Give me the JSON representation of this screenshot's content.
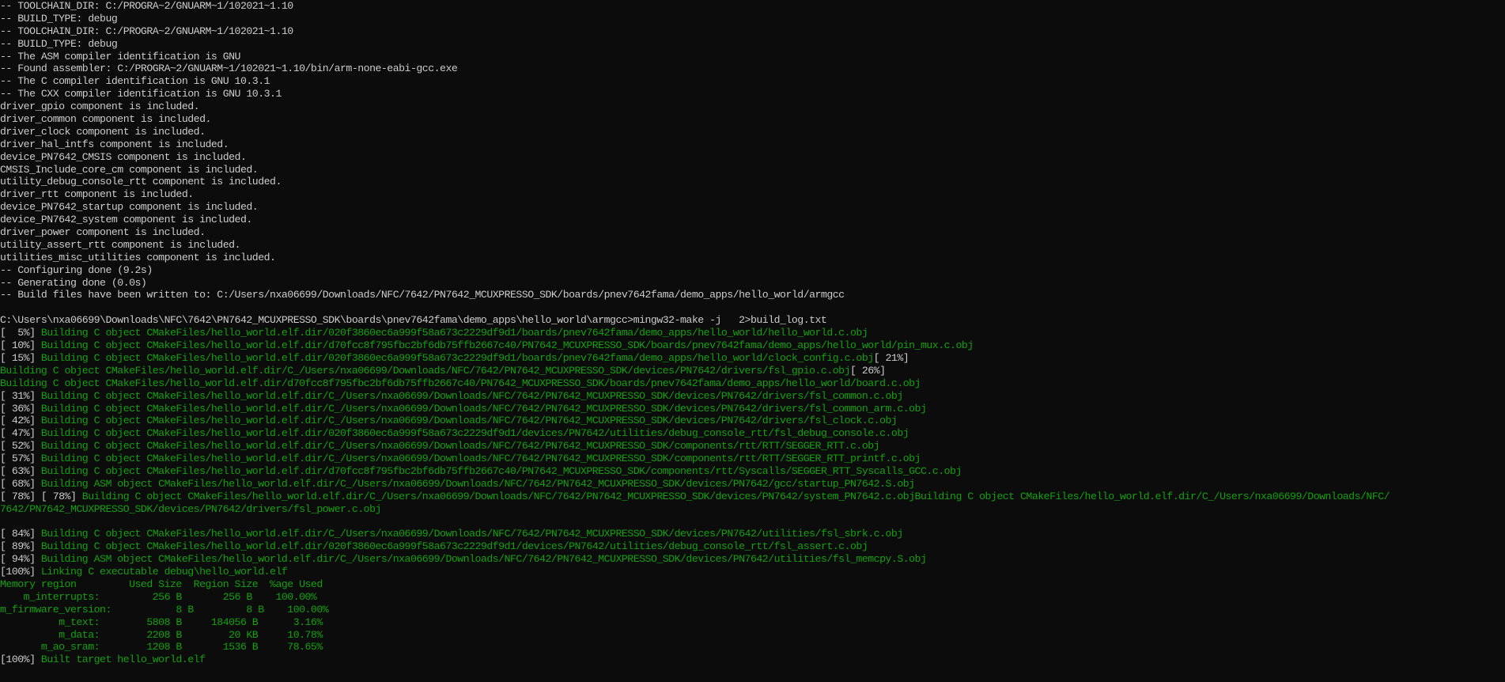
{
  "colors": {
    "background": "#0c0c0c",
    "default_text": "#cccccc",
    "build_text": "#13a10e"
  },
  "lines": [
    {
      "text": "-- TOOLCHAIN_DIR: C:/PROGRA~2/GNUARM~1/102021~1.10",
      "color": "white"
    },
    {
      "text": "-- BUILD_TYPE: debug",
      "color": "white"
    },
    {
      "text": "-- TOOLCHAIN_DIR: C:/PROGRA~2/GNUARM~1/102021~1.10",
      "color": "white"
    },
    {
      "text": "-- BUILD_TYPE: debug",
      "color": "white"
    },
    {
      "text": "-- The ASM compiler identification is GNU",
      "color": "white"
    },
    {
      "text": "-- Found assembler: C:/PROGRA~2/GNUARM~1/102021~1.10/bin/arm-none-eabi-gcc.exe",
      "color": "white"
    },
    {
      "text": "-- The C compiler identification is GNU 10.3.1",
      "color": "white"
    },
    {
      "text": "-- The CXX compiler identification is GNU 10.3.1",
      "color": "white"
    },
    {
      "text": "driver_gpio component is included.",
      "color": "white"
    },
    {
      "text": "driver_common component is included.",
      "color": "white"
    },
    {
      "text": "driver_clock component is included.",
      "color": "white"
    },
    {
      "text": "driver_hal_intfs component is included.",
      "color": "white"
    },
    {
      "text": "device_PN7642_CMSIS component is included.",
      "color": "white"
    },
    {
      "text": "CMSIS_Include_core_cm component is included.",
      "color": "white"
    },
    {
      "text": "utility_debug_console_rtt component is included.",
      "color": "white"
    },
    {
      "text": "driver_rtt component is included.",
      "color": "white"
    },
    {
      "text": "device_PN7642_startup component is included.",
      "color": "white"
    },
    {
      "text": "device_PN7642_system component is included.",
      "color": "white"
    },
    {
      "text": "driver_power component is included.",
      "color": "white"
    },
    {
      "text": "utility_assert_rtt component is included.",
      "color": "white"
    },
    {
      "text": "utilities_misc_utilities component is included.",
      "color": "white"
    },
    {
      "text": "-- Configuring done (9.2s)",
      "color": "white"
    },
    {
      "text": "-- Generating done (0.0s)",
      "color": "white"
    },
    {
      "text": "-- Build files have been written to: C:/Users/nxa06699/Downloads/NFC/7642/PN7642_MCUXPRESSO_SDK/boards/pnev7642fama/demo_apps/hello_world/armgcc",
      "color": "white"
    },
    {
      "text": "",
      "color": "white"
    },
    {
      "text": "C:\\Users\\nxa06699\\Downloads\\NFC\\7642\\PN7642_MCUXPRESSO_SDK\\boards\\pnev7642fama\\demo_apps\\hello_world\\armgcc>mingw32-make -j   2>build_log.txt",
      "color": "white"
    },
    {
      "parts": [
        {
          "text": "[  5%] ",
          "color": "white"
        },
        {
          "text": "Building C object CMakeFiles/hello_world.elf.dir/020f3860ec6a999f58a673c2229df9d1/boards/pnev7642fama/demo_apps/hello_world/hello_world.c.obj",
          "color": "green"
        }
      ]
    },
    {
      "parts": [
        {
          "text": "[ 10%] ",
          "color": "white"
        },
        {
          "text": "Building C object CMakeFiles/hello_world.elf.dir/d70fcc8f795fbc2bf6db75ffb2667c40/PN7642_MCUXPRESSO_SDK/boards/pnev7642fama/demo_apps/hello_world/pin_mux.c.obj",
          "color": "green"
        }
      ]
    },
    {
      "parts": [
        {
          "text": "[ 15%] ",
          "color": "white"
        },
        {
          "text": "Building C object CMakeFiles/hello_world.elf.dir/020f3860ec6a999f58a673c2229df9d1/boards/pnev7642fama/demo_apps/hello_world/clock_config.c.obj",
          "color": "green"
        },
        {
          "text": "[ 21%]",
          "color": "white"
        }
      ]
    },
    {
      "parts": [
        {
          "text": "Building C object CMakeFiles/hello_world.elf.dir/C_/Users/nxa06699/Downloads/NFC/7642/PN7642_MCUXPRESSO_SDK/devices/PN7642/drivers/fsl_gpio.c.obj",
          "color": "green"
        },
        {
          "text": "[ 26%]",
          "color": "white"
        }
      ]
    },
    {
      "parts": [
        {
          "text": "Building C object CMakeFiles/hello_world.elf.dir/d70fcc8f795fbc2bf6db75ffb2667c40/PN7642_MCUXPRESSO_SDK/boards/pnev7642fama/demo_apps/hello_world/board.c.obj",
          "color": "green"
        }
      ]
    },
    {
      "parts": [
        {
          "text": "[ 31%] ",
          "color": "white"
        },
        {
          "text": "Building C object CMakeFiles/hello_world.elf.dir/C_/Users/nxa06699/Downloads/NFC/7642/PN7642_MCUXPRESSO_SDK/devices/PN7642/drivers/fsl_common.c.obj",
          "color": "green"
        }
      ]
    },
    {
      "parts": [
        {
          "text": "[ 36%] ",
          "color": "white"
        },
        {
          "text": "Building C object CMakeFiles/hello_world.elf.dir/C_/Users/nxa06699/Downloads/NFC/7642/PN7642_MCUXPRESSO_SDK/devices/PN7642/drivers/fsl_common_arm.c.obj",
          "color": "green"
        }
      ]
    },
    {
      "parts": [
        {
          "text": "[ 42%] ",
          "color": "white"
        },
        {
          "text": "Building C object CMakeFiles/hello_world.elf.dir/C_/Users/nxa06699/Downloads/NFC/7642/PN7642_MCUXPRESSO_SDK/devices/PN7642/drivers/fsl_clock.c.obj",
          "color": "green"
        }
      ]
    },
    {
      "parts": [
        {
          "text": "[ 47%] ",
          "color": "white"
        },
        {
          "text": "Building C object CMakeFiles/hello_world.elf.dir/020f3860ec6a999f58a673c2229df9d1/devices/PN7642/utilities/debug_console_rtt/fsl_debug_console.c.obj",
          "color": "green"
        }
      ]
    },
    {
      "parts": [
        {
          "text": "[ 52%] ",
          "color": "white"
        },
        {
          "text": "Building C object CMakeFiles/hello_world.elf.dir/C_/Users/nxa06699/Downloads/NFC/7642/PN7642_MCUXPRESSO_SDK/components/rtt/RTT/SEGGER_RTT.c.obj",
          "color": "green"
        }
      ]
    },
    {
      "parts": [
        {
          "text": "[ 57%] ",
          "color": "white"
        },
        {
          "text": "Building C object CMakeFiles/hello_world.elf.dir/C_/Users/nxa06699/Downloads/NFC/7642/PN7642_MCUXPRESSO_SDK/components/rtt/RTT/SEGGER_RTT_printf.c.obj",
          "color": "green"
        }
      ]
    },
    {
      "parts": [
        {
          "text": "[ 63%] ",
          "color": "white"
        },
        {
          "text": "Building C object CMakeFiles/hello_world.elf.dir/d70fcc8f795fbc2bf6db75ffb2667c40/PN7642_MCUXPRESSO_SDK/components/rtt/Syscalls/SEGGER_RTT_Syscalls_GCC.c.obj",
          "color": "green"
        }
      ]
    },
    {
      "parts": [
        {
          "text": "[ 68%] ",
          "color": "white"
        },
        {
          "text": "Building ASM object CMakeFiles/hello_world.elf.dir/C_/Users/nxa06699/Downloads/NFC/7642/PN7642_MCUXPRESSO_SDK/devices/PN7642/gcc/startup_PN7642.S.obj",
          "color": "green"
        }
      ]
    },
    {
      "parts": [
        {
          "text": "[ 78%] [ 78%] ",
          "color": "white"
        },
        {
          "text": "Building C object CMakeFiles/hello_world.elf.dir/C_/Users/nxa06699/Downloads/NFC/7642/PN7642_MCUXPRESSO_SDK/devices/PN7642/system_PN7642.c.objBuilding C object CMakeFiles/hello_world.elf.dir/C_/Users/nxa06699/Downloads/NFC/",
          "color": "green"
        }
      ]
    },
    {
      "text": "7642/PN7642_MCUXPRESSO_SDK/devices/PN7642/drivers/fsl_power.c.obj",
      "color": "green"
    },
    {
      "text": "",
      "color": "white"
    },
    {
      "parts": [
        {
          "text": "[ 84%] ",
          "color": "white"
        },
        {
          "text": "Building C object CMakeFiles/hello_world.elf.dir/C_/Users/nxa06699/Downloads/NFC/7642/PN7642_MCUXPRESSO_SDK/devices/PN7642/utilities/fsl_sbrk.c.obj",
          "color": "green"
        }
      ]
    },
    {
      "parts": [
        {
          "text": "[ 89%] ",
          "color": "white"
        },
        {
          "text": "Building C object CMakeFiles/hello_world.elf.dir/020f3860ec6a999f58a673c2229df9d1/devices/PN7642/utilities/debug_console_rtt/fsl_assert.c.obj",
          "color": "green"
        }
      ]
    },
    {
      "parts": [
        {
          "text": "[ 94%] ",
          "color": "white"
        },
        {
          "text": "Building ASM object CMakeFiles/hello_world.elf.dir/C_/Users/nxa06699/Downloads/NFC/7642/PN7642_MCUXPRESSO_SDK/devices/PN7642/utilities/fsl_memcpy.S.obj",
          "color": "green"
        }
      ]
    },
    {
      "parts": [
        {
          "text": "[100%] ",
          "color": "white"
        },
        {
          "text": "Linking C executable debug\\hello_world.elf",
          "color": "green"
        }
      ]
    },
    {
      "text": "Memory region         Used Size  Region Size  %age Used",
      "color": "green"
    },
    {
      "text": "    m_interrupts:         256 B       256 B    100.00%",
      "color": "green"
    },
    {
      "text": "m_firmware_version:           8 B         8 B    100.00%",
      "color": "green"
    },
    {
      "text": "          m_text:        5808 B     184056 B      3.16%",
      "color": "green"
    },
    {
      "text": "          m_data:        2208 B        20 KB     10.78%",
      "color": "green"
    },
    {
      "text": "       m_ao_sram:        1208 B       1536 B     78.65%",
      "color": "green"
    },
    {
      "parts": [
        {
          "text": "[100%] ",
          "color": "white"
        },
        {
          "text": "Built target hello_world.elf",
          "color": "green"
        }
      ]
    }
  ]
}
